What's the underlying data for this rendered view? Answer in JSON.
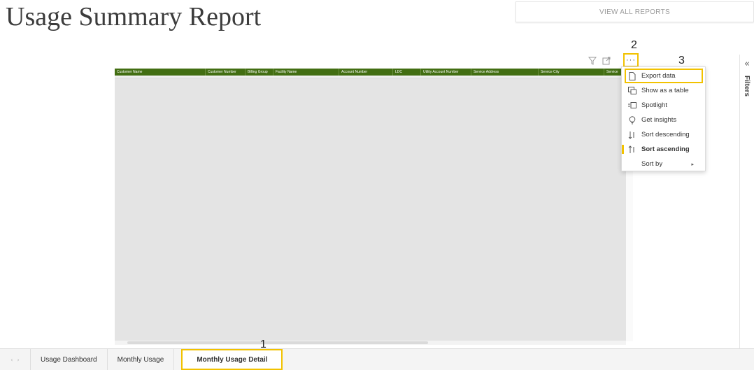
{
  "page": {
    "title": "Usage Summary Report",
    "view_all_label": "VIEW ALL REPORTS"
  },
  "visual": {
    "columns": [
      "Customer Name",
      "Customer Number",
      "Billing Group",
      "Facility Name",
      "Account Number",
      "LDC",
      "Utility Account Number",
      "Service Address",
      "Service City",
      "Service"
    ],
    "more_options_label": "···",
    "filter_icon": "filter-icon",
    "focus_icon": "focus-mode-icon"
  },
  "context_menu": {
    "items": [
      {
        "label": "Export data",
        "icon": "document-icon",
        "glyph": "🗋"
      },
      {
        "label": "Show as a table",
        "icon": "table-view-icon",
        "glyph": "⊞"
      },
      {
        "label": "Spotlight",
        "icon": "spotlight-icon",
        "glyph": "▭"
      },
      {
        "label": "Get insights",
        "icon": "lightbulb-icon",
        "glyph": "💡"
      },
      {
        "label": "Sort descending",
        "icon": "sort-descending-icon",
        "glyph": "↓"
      },
      {
        "label": "Sort ascending",
        "icon": "sort-ascending-icon",
        "glyph": "↑"
      },
      {
        "label": "Sort by",
        "icon": "",
        "glyph": ""
      }
    ],
    "submenu_arrow": "▸"
  },
  "callouts": {
    "one": "1",
    "two": "2",
    "three": "3"
  },
  "filters": {
    "label": "Filters",
    "collapse_glyph": "«"
  },
  "tabs": {
    "nav_prev": "‹",
    "nav_next": "›",
    "items": [
      "Usage Dashboard",
      "Monthly Usage",
      "Monthly Usage Detail"
    ],
    "active_index": 2
  },
  "colors": {
    "header_green": "#426e12",
    "highlight_yellow": "#f2c200"
  }
}
